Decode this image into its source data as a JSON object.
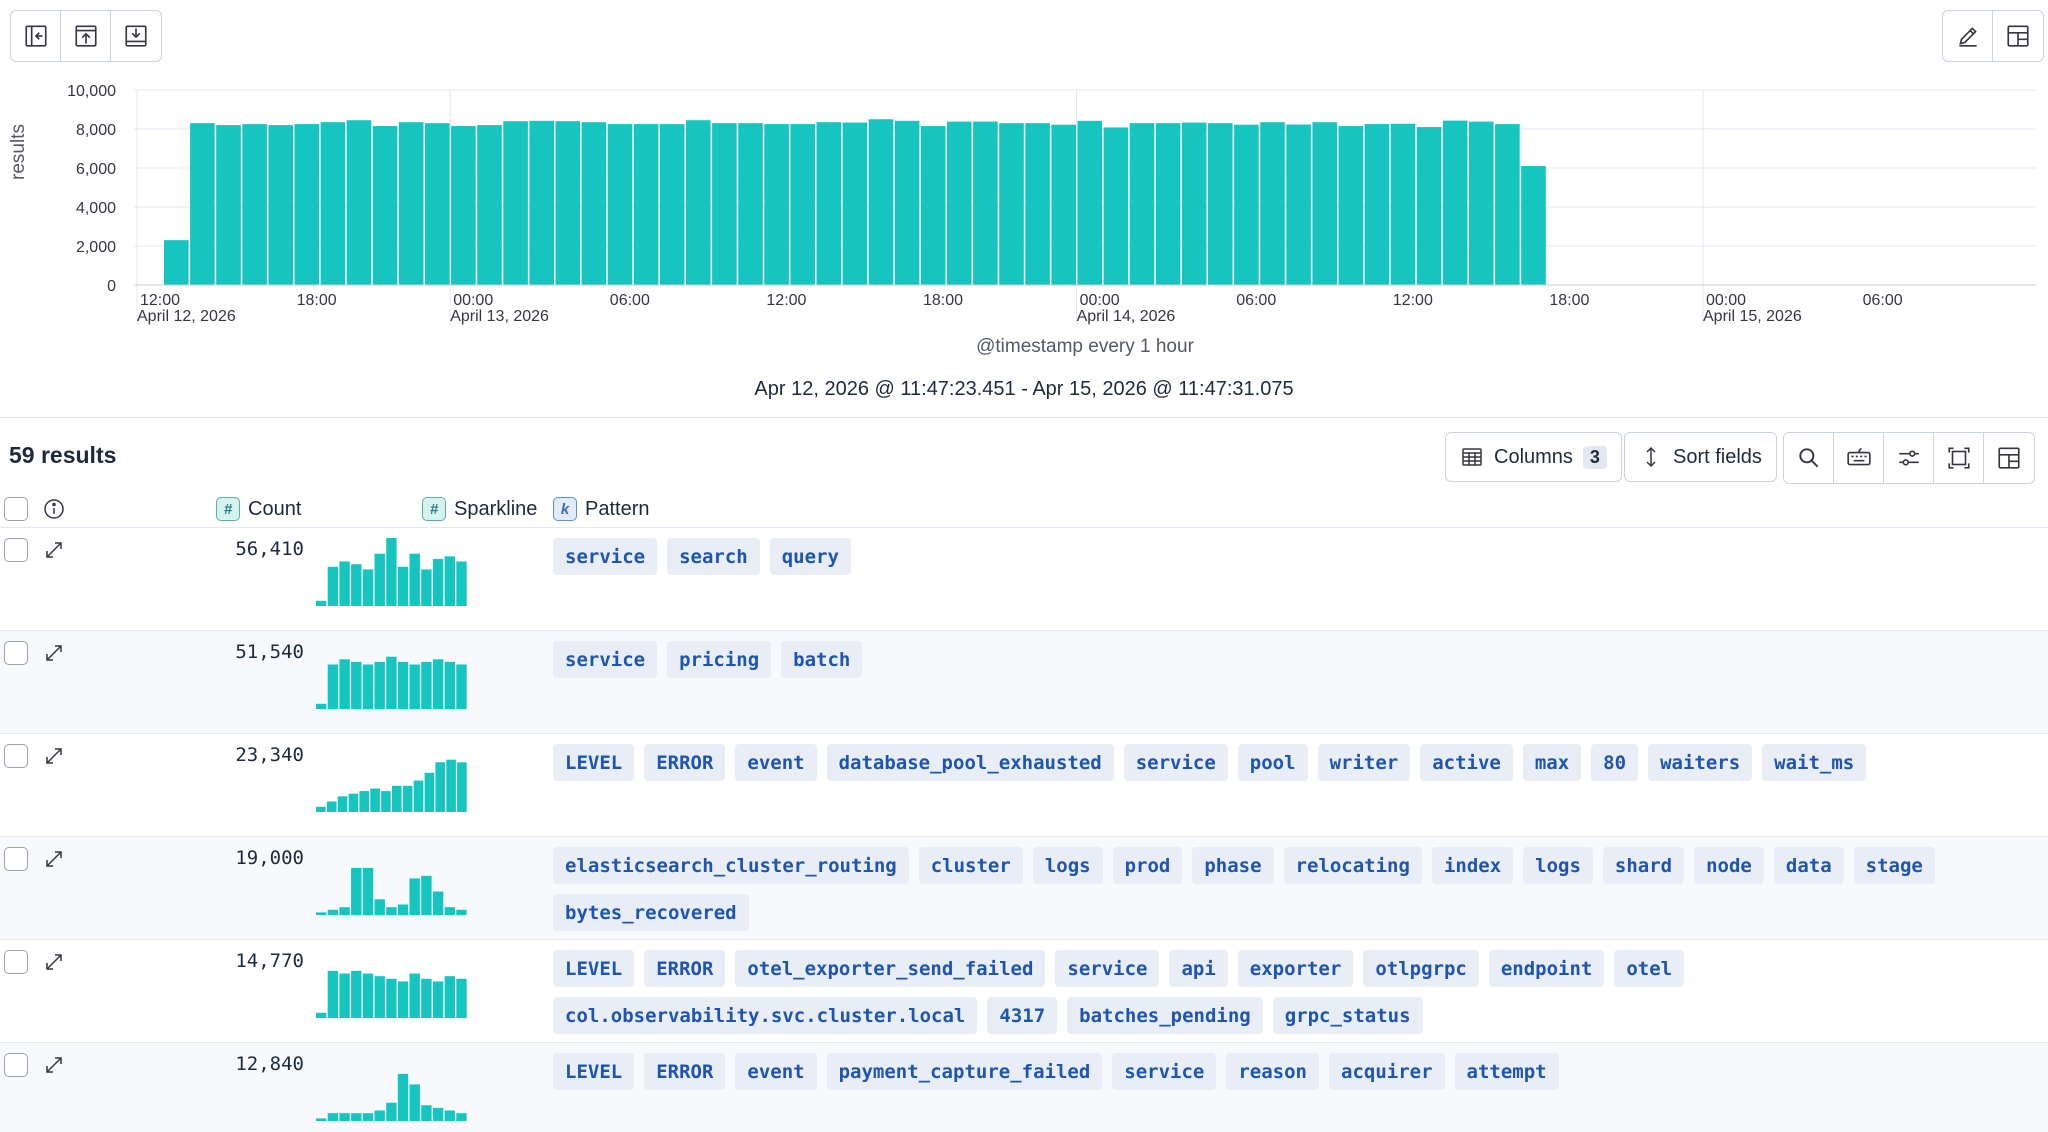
{
  "toolbar_left": [
    {
      "name": "collapse-sidebar-icon"
    },
    {
      "name": "export-icon"
    },
    {
      "name": "download-icon"
    }
  ],
  "toolbar_right": [
    {
      "name": "edit-icon"
    },
    {
      "name": "layout-icon"
    }
  ],
  "chart_data": {
    "type": "bar",
    "ylabel": "results",
    "xlabel": "@timestamp every 1 hour",
    "ylim": [
      0,
      10000
    ],
    "yticks": [
      "10,000",
      "8,000",
      "6,000",
      "4,000",
      "2,000",
      "0"
    ],
    "ytick_values": [
      10000,
      8000,
      6000,
      4000,
      2000,
      0
    ],
    "xticks": [
      {
        "time": "12:00",
        "date": "April 12, 2026",
        "hour": 0
      },
      {
        "time": "18:00",
        "date": "",
        "hour": 6
      },
      {
        "time": "00:00",
        "date": "April 13, 2026",
        "hour": 12
      },
      {
        "time": "06:00",
        "date": "",
        "hour": 18
      },
      {
        "time": "12:00",
        "date": "",
        "hour": 24
      },
      {
        "time": "18:00",
        "date": "",
        "hour": 30
      },
      {
        "time": "00:00",
        "date": "April 14, 2026",
        "hour": 36
      },
      {
        "time": "06:00",
        "date": "",
        "hour": 42
      },
      {
        "time": "12:00",
        "date": "",
        "hour": 48
      },
      {
        "time": "18:00",
        "date": "",
        "hour": 54
      },
      {
        "time": "00:00",
        "date": "April 15, 2026",
        "hour": 60
      },
      {
        "time": "06:00",
        "date": "",
        "hour": 66
      }
    ],
    "color": "#16c5c0",
    "values": [
      2300,
      8300,
      8200,
      8250,
      8200,
      8250,
      8350,
      8450,
      8150,
      8350,
      8300,
      8150,
      8200,
      8400,
      8420,
      8400,
      8350,
      8250,
      8250,
      8250,
      8450,
      8300,
      8300,
      8250,
      8250,
      8350,
      8330,
      8500,
      8420,
      8150,
      8380,
      8380,
      8300,
      8300,
      8220,
      8420,
      8080,
      8300,
      8300,
      8330,
      8300,
      8220,
      8350,
      8230,
      8350,
      8150,
      8250,
      8270,
      8100,
      8430,
      8380,
      8250,
      6100
    ]
  },
  "time_range": "Apr 12, 2026 @ 11:47:23.451 - Apr 15, 2026 @ 11:47:31.075",
  "results_label": "59 results",
  "columns_button": {
    "label": "Columns",
    "count": "3"
  },
  "sort_button": {
    "label": "Sort fields"
  },
  "grid_tools": [
    {
      "name": "search-icon"
    },
    {
      "name": "keyboard-icon"
    },
    {
      "name": "display-options-icon"
    },
    {
      "name": "fullscreen-icon"
    },
    {
      "name": "layout-icon"
    }
  ],
  "headers": {
    "count": "Count",
    "sparkline": "Sparkline",
    "pattern": "Pattern",
    "num_token": "#",
    "kw_token": "k"
  },
  "rows": [
    {
      "count": "56,410",
      "spark": [
        2,
        15,
        17,
        16,
        14,
        20,
        26,
        15,
        20,
        14,
        18,
        19,
        17
      ],
      "tokens": [
        "service",
        "search",
        "query"
      ]
    },
    {
      "count": "51,540",
      "spark": [
        2,
        17,
        19,
        18,
        17,
        18,
        20,
        18,
        17,
        18,
        19,
        18,
        17
      ],
      "tokens": [
        "service",
        "pricing",
        "batch"
      ]
    },
    {
      "count": "23,340",
      "spark": [
        2,
        4,
        6,
        7,
        8,
        9,
        8,
        10,
        10,
        12,
        15,
        19,
        20,
        19
      ],
      "tokens": [
        "LEVEL",
        "ERROR",
        "event",
        "database_pool_exhausted",
        "service",
        "pool",
        "writer",
        "active",
        "max",
        "80",
        "waiters",
        "wait_ms"
      ]
    },
    {
      "count": "19,000",
      "spark": [
        1,
        2,
        3,
        18,
        18,
        6,
        3,
        4,
        14,
        15,
        9,
        3,
        2
      ],
      "tokens": [
        "elasticsearch_cluster_routing",
        "cluster",
        "logs",
        "prod",
        "phase",
        "relocating",
        "index",
        "logs",
        "shard",
        "node",
        "data",
        "stage",
        "bytes_recovered"
      ]
    },
    {
      "count": "14,770",
      "spark": [
        2,
        18,
        17,
        18,
        17,
        16,
        15,
        14,
        17,
        15,
        14,
        16,
        15
      ],
      "tokens": [
        "LEVEL",
        "ERROR",
        "otel_exporter_send_failed",
        "service",
        "api",
        "exporter",
        "otlpgrpc",
        "endpoint",
        "otel",
        "col.observability.svc.cluster.local",
        "4317",
        "batches_pending",
        "grpc_status"
      ]
    },
    {
      "count": "12,840",
      "spark": [
        1,
        3,
        3,
        3,
        3,
        4,
        7,
        18,
        14,
        6,
        5,
        4,
        3
      ],
      "tokens": [
        "LEVEL",
        "ERROR",
        "event",
        "payment_capture_failed",
        "service",
        "reason",
        "acquirer",
        "attempt"
      ]
    }
  ]
}
